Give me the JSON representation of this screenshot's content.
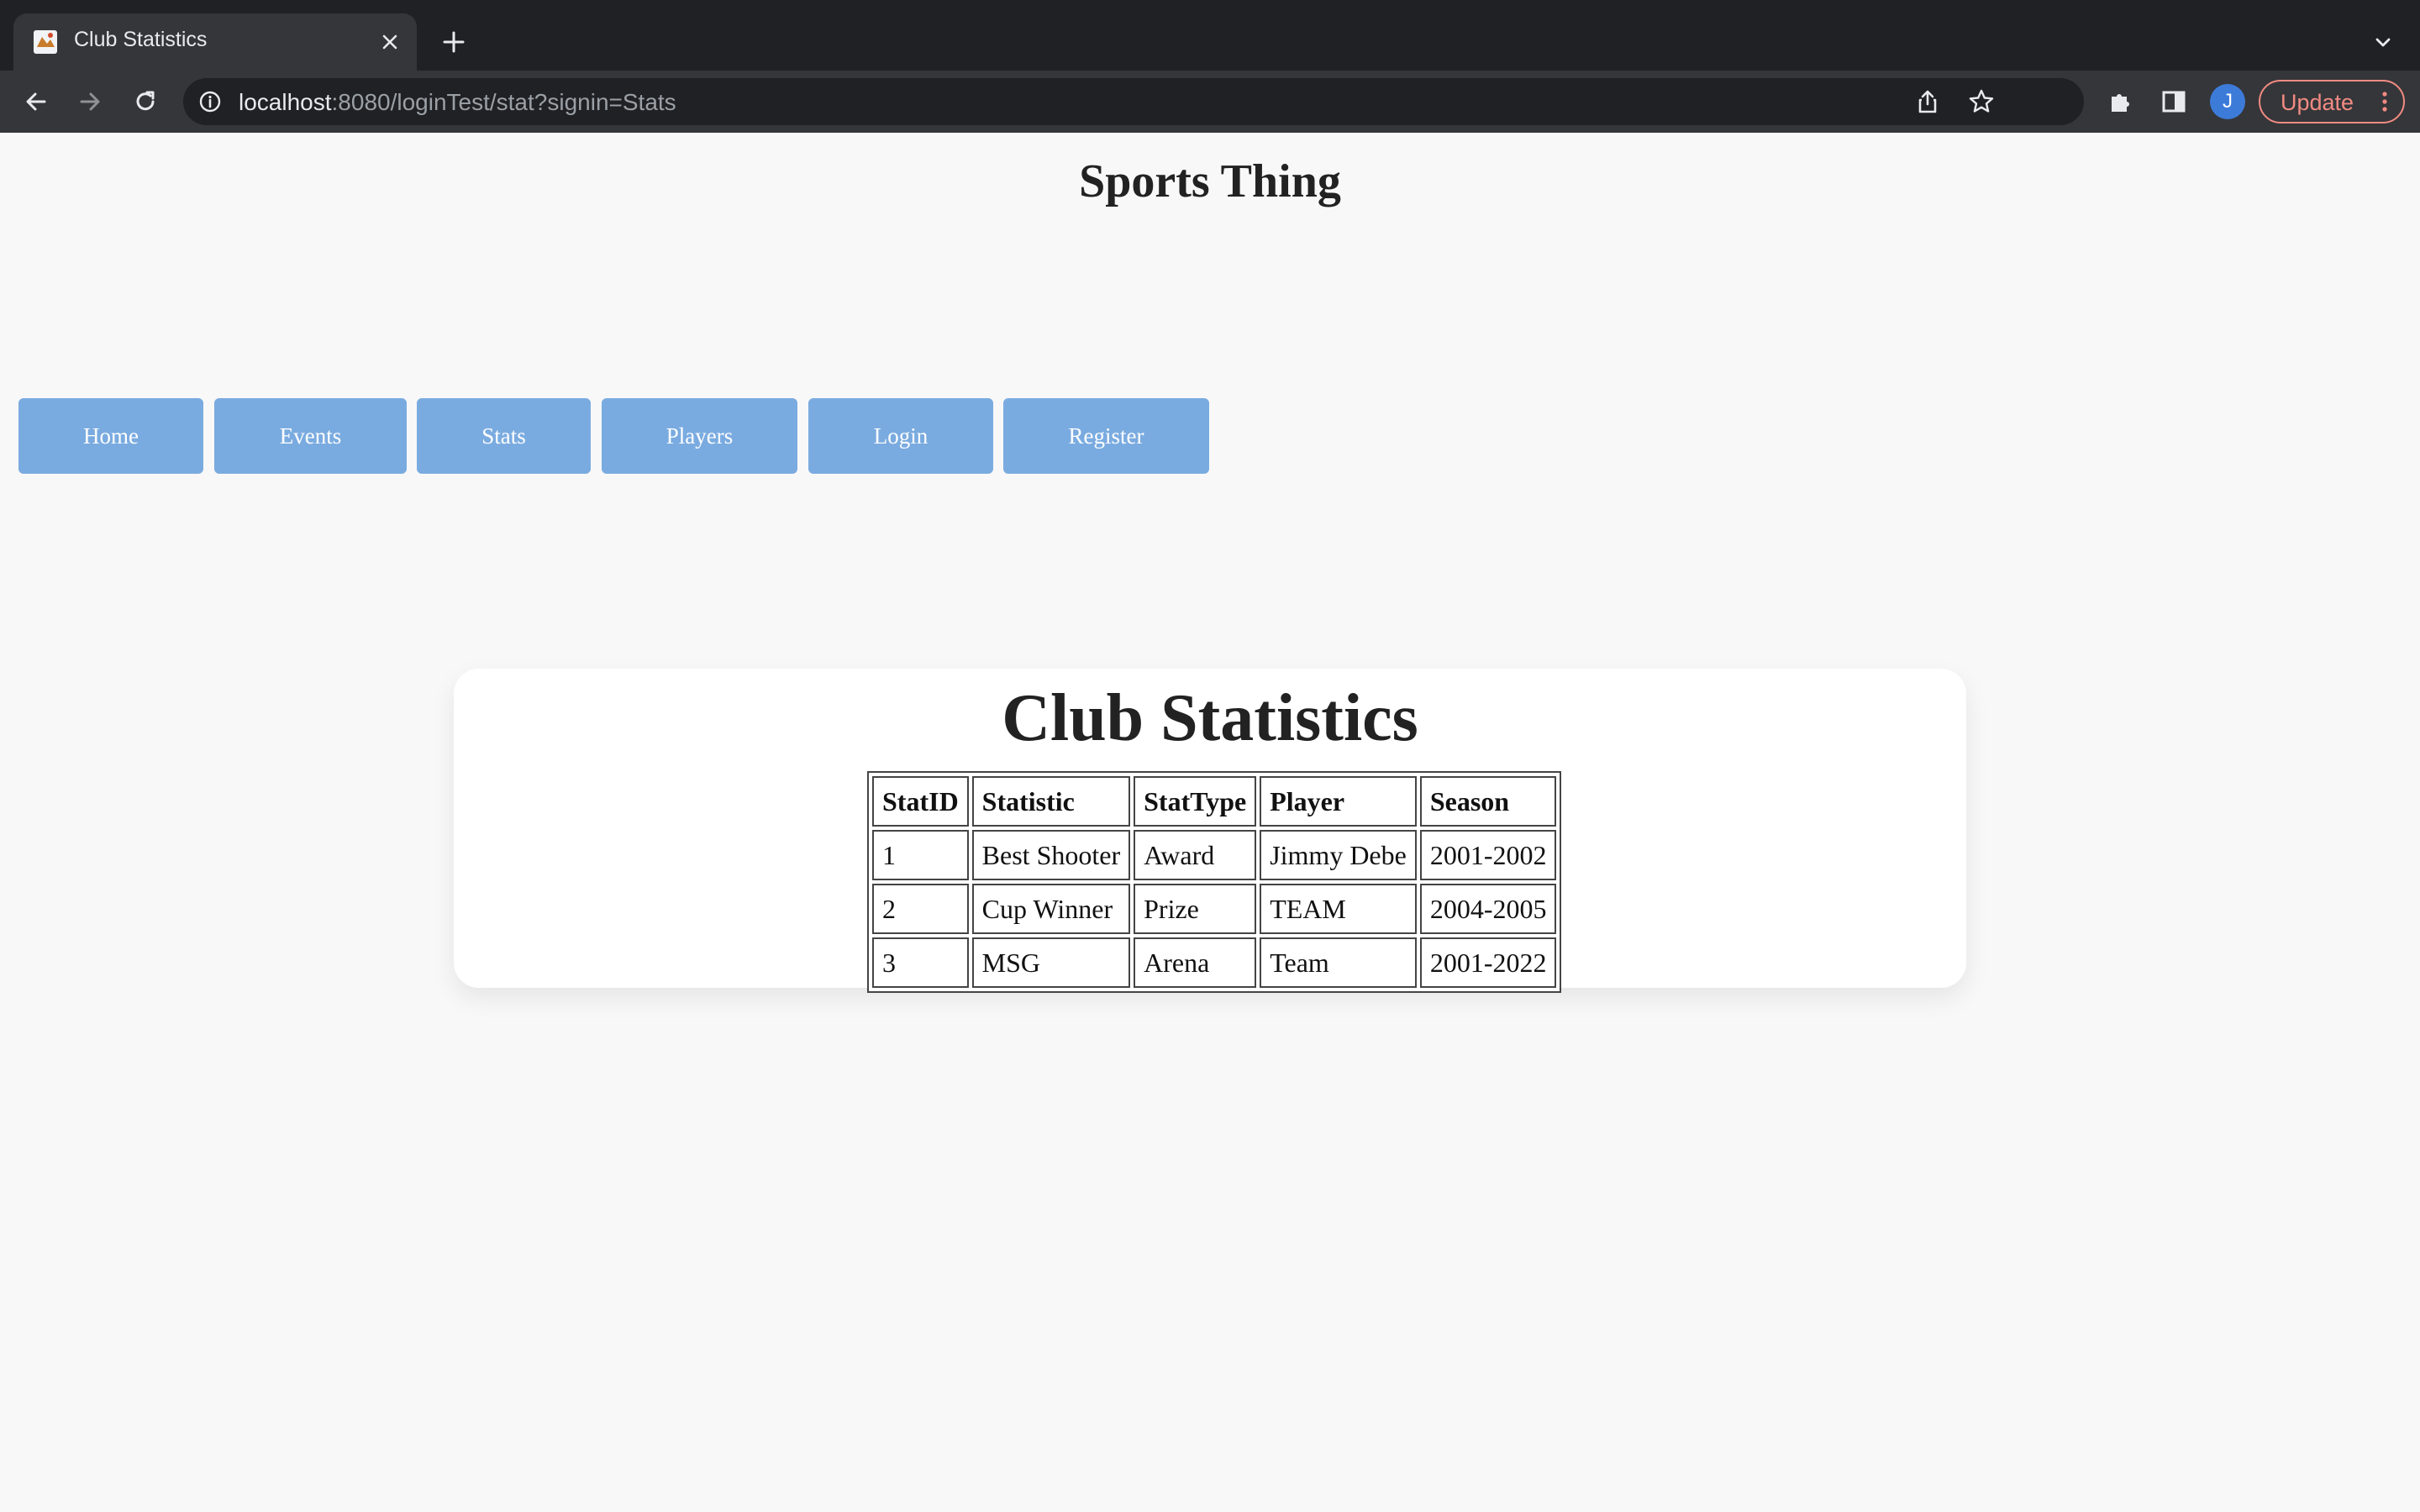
{
  "browser": {
    "tab_title": "Club Statistics",
    "url_host": "localhost",
    "url_rest": ":8080/loginTest/stat?signin=Stats",
    "avatar_initial": "J",
    "update_label": "Update"
  },
  "page": {
    "site_title": "Sports Thing",
    "nav": [
      {
        "label": "Home"
      },
      {
        "label": "Events"
      },
      {
        "label": "Stats"
      },
      {
        "label": "Players"
      },
      {
        "label": "Login"
      },
      {
        "label": "Register"
      }
    ],
    "card_title": "Club Statistics",
    "table": {
      "headers": [
        "StatID",
        "Statistic",
        "StatType",
        "Player",
        "Season"
      ],
      "rows": [
        [
          "1",
          "Best Shooter",
          "Award",
          "Jimmy Debe",
          "2001-2002"
        ],
        [
          "2",
          "Cup Winner",
          "Prize",
          "TEAM",
          "2004-2005"
        ],
        [
          "3",
          "MSG",
          "Arena",
          "Team",
          "2001-2022"
        ]
      ]
    }
  },
  "colors": {
    "nav_button_bg": "#7aabe0",
    "page_bg": "#f8f8f8",
    "update_accent": "#f28b82"
  }
}
